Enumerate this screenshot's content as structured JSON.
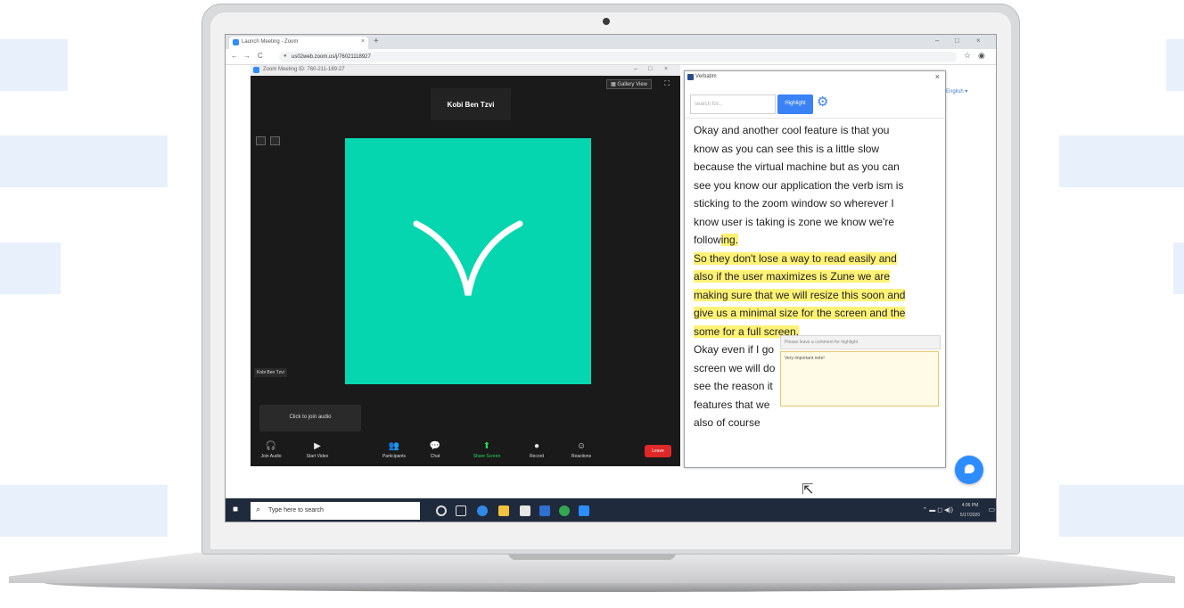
{
  "browser": {
    "tab_title": "Launch Meeting - Zoom",
    "url": "us02web.zoom.us/j/76021118927",
    "new_tab": "+",
    "close": "×",
    "back": "←",
    "forward": "→",
    "reload": "C",
    "minimize": "–",
    "maximize": "□"
  },
  "zoom": {
    "window_title": "Zoom Meeting ID: 760-211-189-27",
    "speaker_name": "Kobi Ben Tzvi",
    "gallery_view": "Gallery View",
    "name_tag": "Kobi Ben Tzvi",
    "join_audio": "Click to join audio",
    "toolbar": [
      {
        "label": "Join Audio",
        "icon": "headphones-icon",
        "glyph": "🎧"
      },
      {
        "label": "Start Video",
        "icon": "video-off-icon",
        "glyph": "▶"
      },
      {
        "label": "Participants",
        "icon": "participants-icon",
        "glyph": "👥"
      },
      {
        "label": "Chat",
        "icon": "chat-icon",
        "glyph": "💬"
      },
      {
        "label": "Share Screen",
        "icon": "share-screen-icon",
        "glyph": "⬆"
      },
      {
        "label": "Record",
        "icon": "record-icon",
        "glyph": "●"
      },
      {
        "label": "Reactions",
        "icon": "reactions-icon",
        "glyph": "☺"
      }
    ],
    "leave": "Leave"
  },
  "page_behind": {
    "link": "English ▾"
  },
  "verbatim": {
    "title": "Verbatim",
    "search_placeholder": "search for...",
    "highlight_button": "Highlight",
    "transcript": [
      {
        "text": "Okay and another cool feature is that you",
        "hl": ""
      },
      {
        "text": "know as you can see this is a little slow",
        "hl": ""
      },
      {
        "text": "because the virtual machine but as you can",
        "hl": ""
      },
      {
        "text": "see you know our application the verb ism is",
        "hl": ""
      },
      {
        "text": "sticking to the zoom window so wherever I",
        "hl": ""
      },
      {
        "text": "know user is taking is zone we know we're",
        "hl": ""
      },
      {
        "text": "follow",
        "hl": "ing."
      },
      {
        "text": "",
        "hl": "So they don't lose a way to read easily and"
      },
      {
        "text": "",
        "hl": "also if the user maximizes is Zune we are"
      },
      {
        "text": "",
        "hl": "making sure that we will resize this soon and"
      },
      {
        "text": "",
        "hl": "give us a minimal size for the screen and the"
      },
      {
        "text": "",
        "hl": "some for a full screen."
      },
      {
        "text": "Okay even if I go",
        "hl": ""
      },
      {
        "text": "screen we will do",
        "hl": ""
      },
      {
        "text": "see the reason it",
        "hl": ""
      },
      {
        "text": "features that we",
        "hl": ""
      },
      {
        "text": "also of course",
        "hl": ""
      }
    ],
    "comment_placeholder": "Please leave a comment for highlight",
    "comment_text": "Very important note!"
  },
  "taskbar": {
    "search_text": "Type here to search",
    "time": "4:06 PM",
    "date": "5/17/2020"
  },
  "colors": {
    "zoom_bg": "#1a1a1a",
    "avatar": "#06d6b0",
    "highlight": "#fff275",
    "accent": "#2d8cff",
    "leave": "#e02828"
  }
}
